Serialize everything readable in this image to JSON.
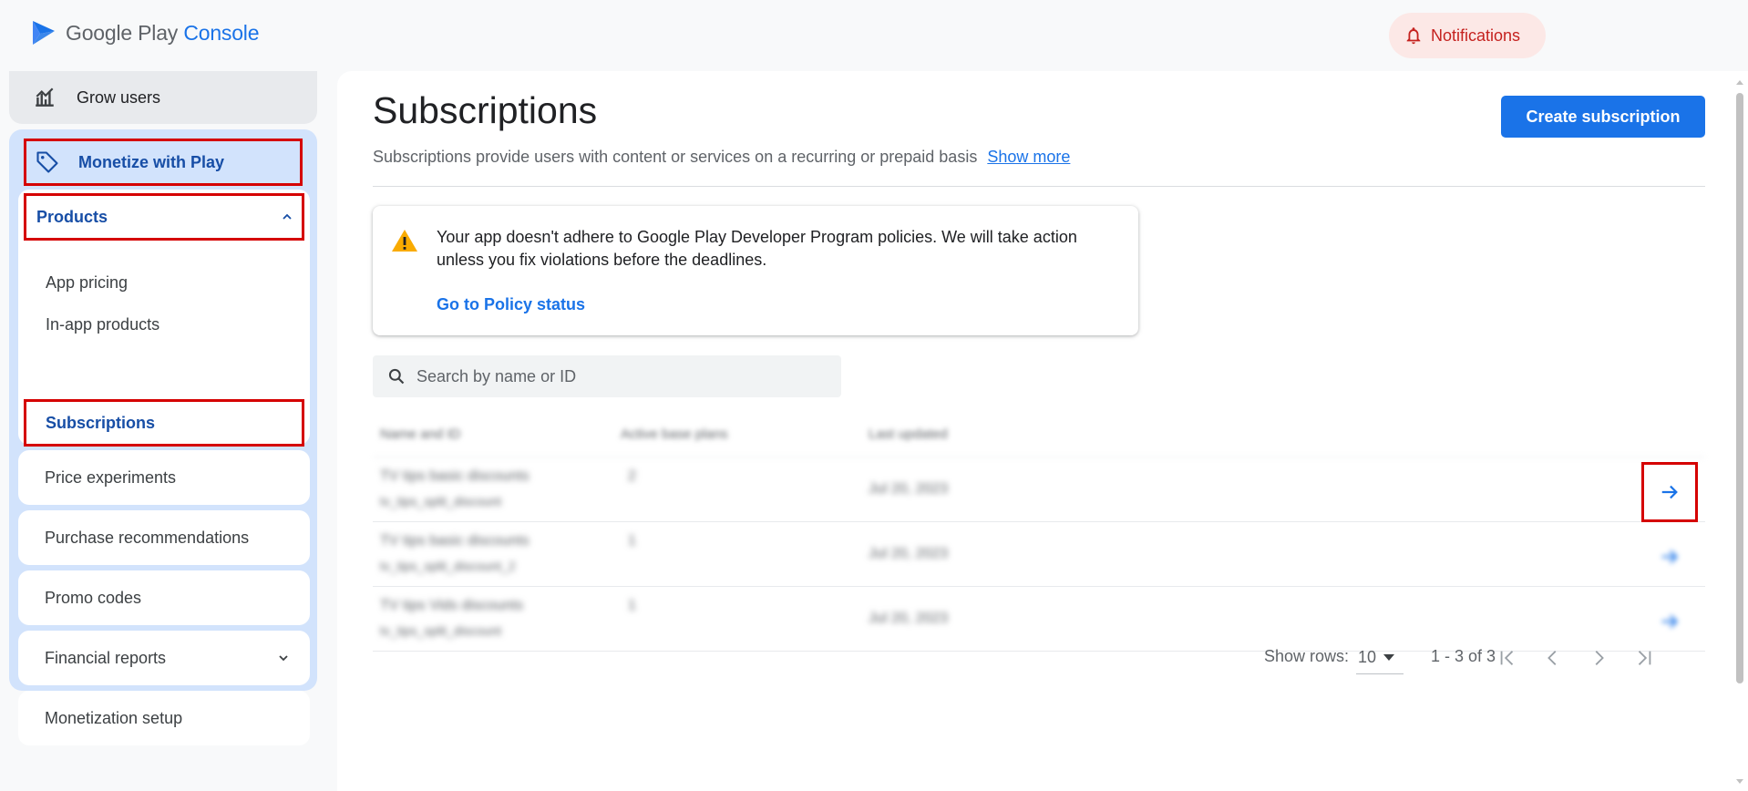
{
  "app": {
    "logo_google_play": "Google Play",
    "logo_console": "Console",
    "notifications_label": "Notifications"
  },
  "sidebar": {
    "grow_users": "Grow users",
    "monetize_with_play": "Monetize with Play",
    "products": "Products",
    "products_items": [
      "App pricing",
      "In-app products",
      "Subscriptions"
    ],
    "price_experiments": "Price experiments",
    "purchase_recommendations": "Purchase recommendations",
    "promo_codes": "Promo codes",
    "financial_reports": "Financial reports",
    "monetization_setup": "Monetization setup"
  },
  "main": {
    "title": "Subscriptions",
    "subtitle": "Subscriptions provide users with content or services on a recurring or prepaid basis",
    "show_more": "Show more",
    "create_button": "Create subscription",
    "alert": {
      "text": "Your app doesn't adhere to Google Play Developer Program policies. We will take action unless you fix violations before the deadlines.",
      "link": "Go to Policy status"
    },
    "search": {
      "placeholder": "Search by name or ID"
    },
    "table": {
      "headers": [
        "Name and ID",
        "Active base plans",
        "Last updated"
      ],
      "rows": [
        {
          "name": "TV tips basic discounts",
          "id": "tv_tips_split_discount",
          "plans": "2",
          "updated": "Jul 20, 2023"
        },
        {
          "name": "TV tips basic discounts",
          "id": "tv_tips_split_discount_2",
          "plans": "1",
          "updated": "Jul 20, 2023"
        },
        {
          "name": "TV tips Vids discounts",
          "id": "tv_tips_split_discount",
          "plans": "1",
          "updated": "Jul 20, 2023"
        }
      ]
    },
    "pager": {
      "show_rows_label": "Show rows:",
      "rows_value": "10",
      "range": "1 - 3 of 3"
    }
  },
  "colors": {
    "accent": "#1a73e8",
    "highlight_outline": "#d50000",
    "sidebar_group": "#d2e3fc",
    "notification_bg": "#fce8e6"
  }
}
